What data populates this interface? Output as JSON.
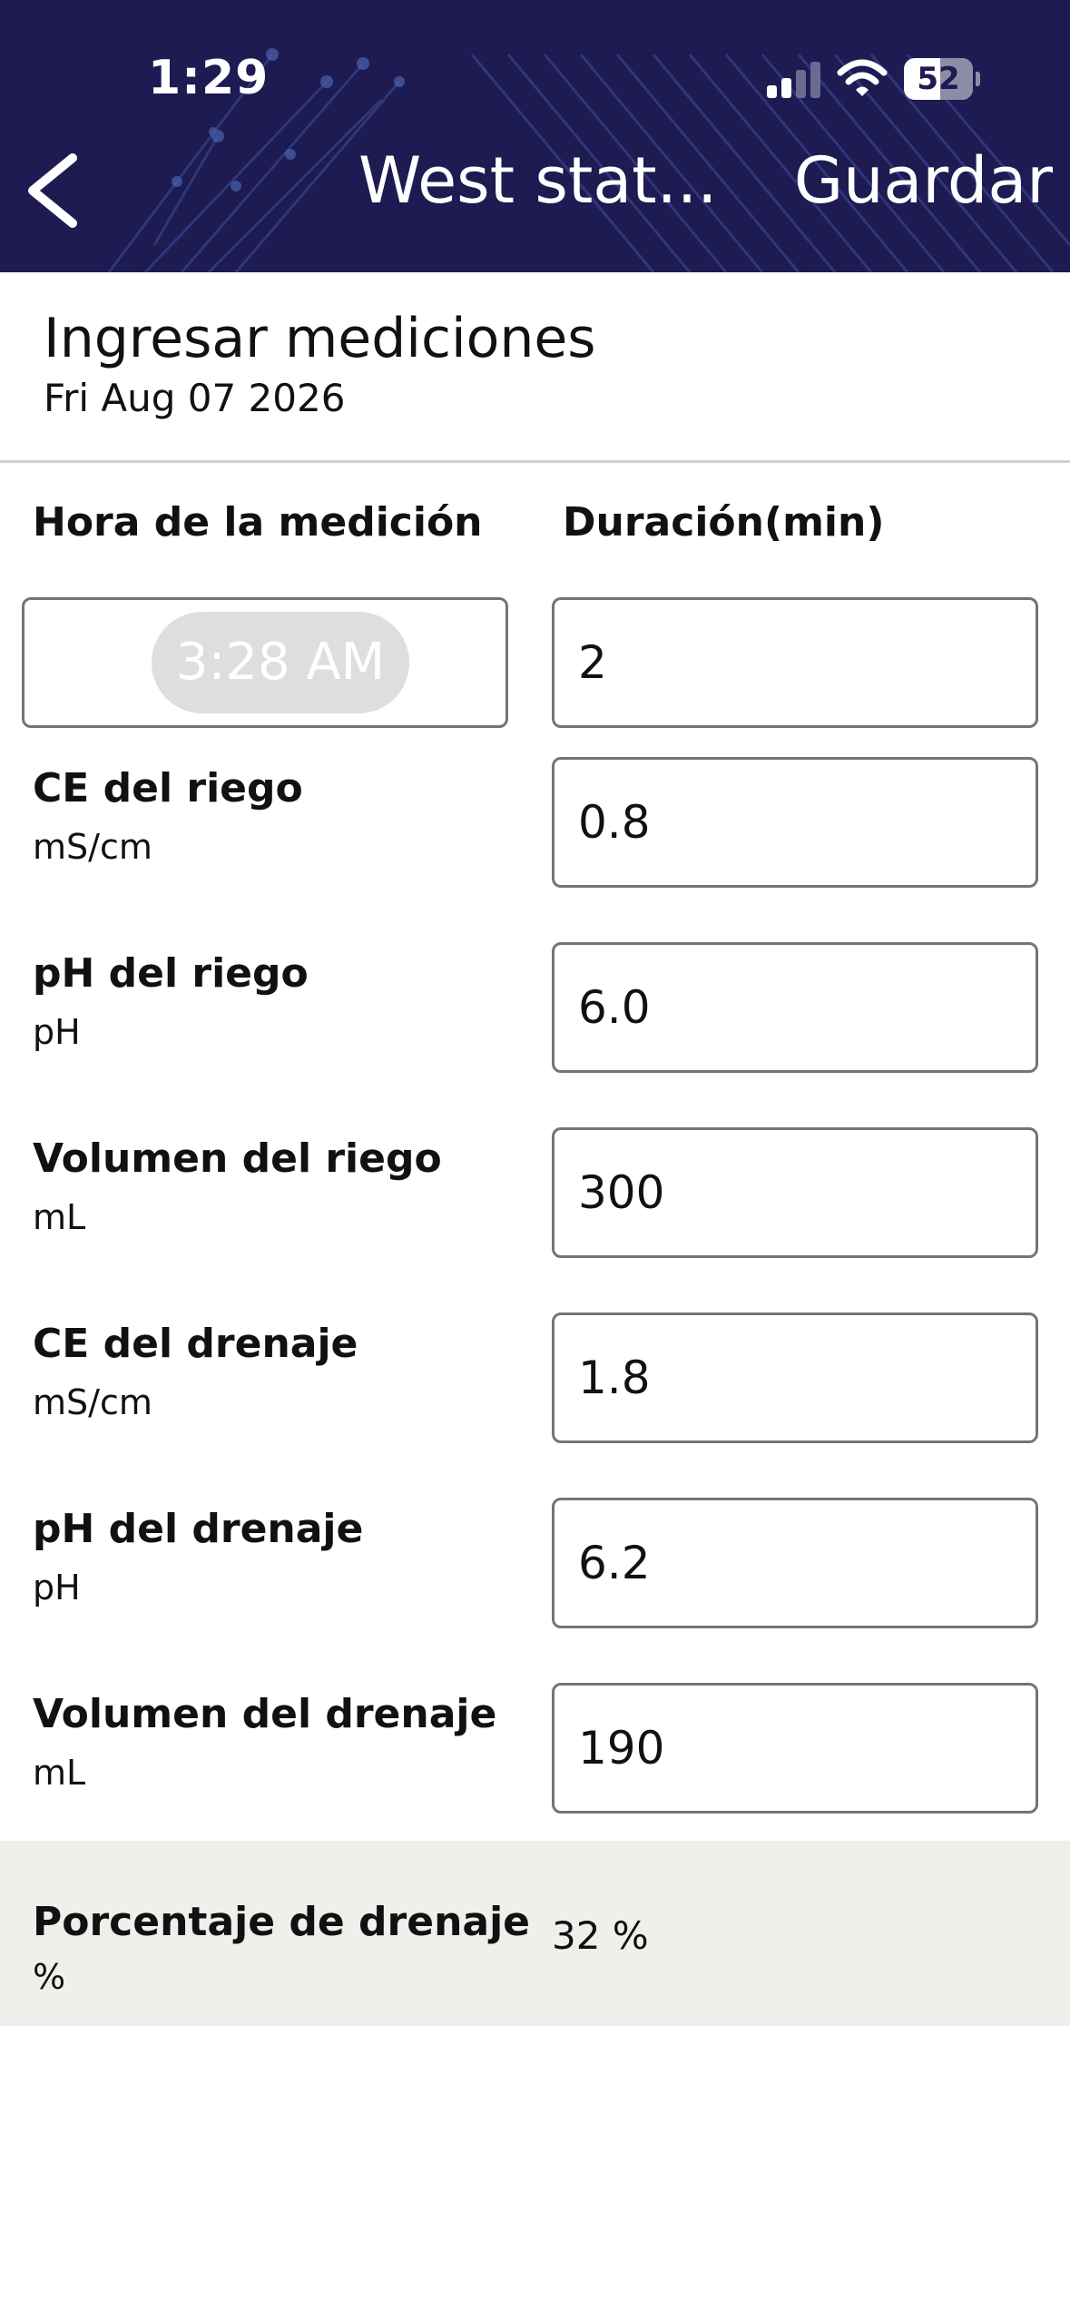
{
  "status_bar": {
    "time": "1:29",
    "battery_level": "52",
    "battery_fraction": 0.52
  },
  "nav": {
    "back_icon": "chevron-left-icon",
    "title": "West stat...",
    "save_label": "Guardar"
  },
  "section": {
    "title": "Ingresar mediciones",
    "date": "Fri Aug 07 2026"
  },
  "columns": {
    "time_header": "Hora de la medición",
    "duration_header": "Duración(min)"
  },
  "measurement_time": "3:28 AM",
  "duration": "2",
  "rows": [
    {
      "label": "CE del riego",
      "unit": "mS/cm",
      "value": "0.8"
    },
    {
      "label": "pH del riego",
      "unit": "pH",
      "value": "6.0"
    },
    {
      "label": "Volumen del riego",
      "unit": "mL",
      "value": "300"
    },
    {
      "label": "CE del drenaje",
      "unit": "mS/cm",
      "value": "1.8"
    },
    {
      "label": "pH del drenaje",
      "unit": "pH",
      "value": "6.2"
    },
    {
      "label": "Volumen del drenaje",
      "unit": "mL",
      "value": "190"
    }
  ],
  "summary": {
    "label": "Porcentaje de drenaje",
    "unit": "%",
    "value": "32 %"
  },
  "colors": {
    "header_bg": "#1e1a52",
    "field_border": "#77746e",
    "summary_bg": "#eff0ec",
    "divider": "#cfd0c8"
  }
}
